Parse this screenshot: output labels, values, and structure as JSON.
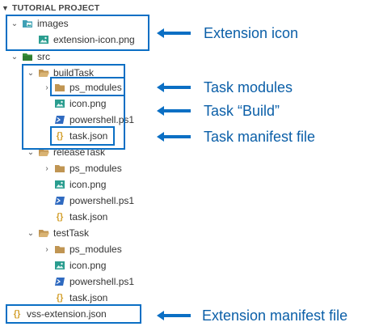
{
  "explorer": {
    "header": "TUTORIAL PROJECT",
    "items": [
      {
        "label": "images",
        "kind": "folder-images",
        "expanded": true
      },
      {
        "label": "extension-icon.png",
        "kind": "image"
      },
      {
        "label": "src",
        "kind": "folder-src",
        "expanded": true
      },
      {
        "label": "buildTask",
        "kind": "folder",
        "expanded": true
      },
      {
        "label": "ps_modules",
        "kind": "folder",
        "expanded": false
      },
      {
        "label": "icon.png",
        "kind": "image"
      },
      {
        "label": "powershell.ps1",
        "kind": "ps1"
      },
      {
        "label": "task.json",
        "kind": "json"
      },
      {
        "label": "releaseTask",
        "kind": "folder",
        "expanded": true
      },
      {
        "label": "ps_modules",
        "kind": "folder",
        "expanded": false
      },
      {
        "label": "icon.png",
        "kind": "image"
      },
      {
        "label": "powershell.ps1",
        "kind": "ps1"
      },
      {
        "label": "task.json",
        "kind": "json"
      },
      {
        "label": "testTask",
        "kind": "folder",
        "expanded": true
      },
      {
        "label": "ps_modules",
        "kind": "folder",
        "expanded": false
      },
      {
        "label": "icon.png",
        "kind": "image"
      },
      {
        "label": "powershell.ps1",
        "kind": "ps1"
      },
      {
        "label": "task.json",
        "kind": "json"
      },
      {
        "label": "vss-extension.json",
        "kind": "json"
      }
    ]
  },
  "callouts": {
    "extension_icon": "Extension icon",
    "task_modules": "Task modules",
    "task_build": "Task “Build”",
    "task_manifest": "Task manifest file",
    "extension_manifest": "Extension manifest file"
  },
  "colors": {
    "accent": "#0b6fc4",
    "callout_text": "#0b5fa8",
    "folder": "#c09553",
    "image_icon": "#2a9d8f",
    "ps1_icon": "#2f6ac0",
    "json_icon": "#d3a02e",
    "src_folder": "#3a8f3a"
  }
}
